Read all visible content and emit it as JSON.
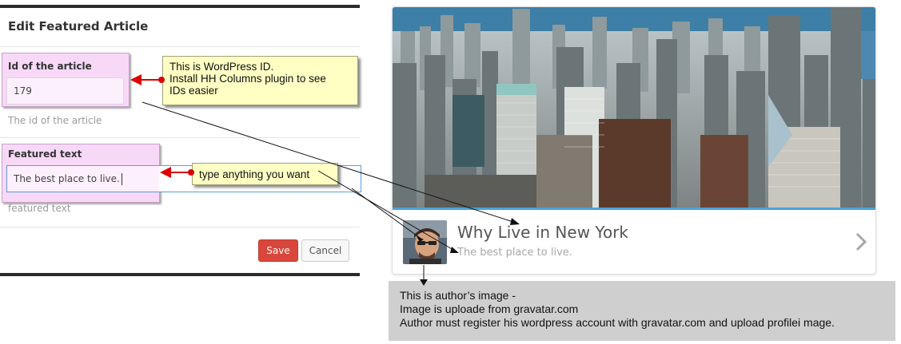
{
  "editor": {
    "title": "Edit Featured Article",
    "fields": [
      {
        "label": "Id of the article",
        "value": "179",
        "help": "The id of the article"
      },
      {
        "label": "Featured text",
        "value": "The best place to live.",
        "help": "featured text"
      }
    ],
    "save_label": "Save",
    "cancel_label": "Cancel"
  },
  "callouts": {
    "id_note": [
      "This is WordPress ID.",
      "Install HH Columns plugin to see",
      "IDs easier"
    ],
    "text_note": "type anything you want"
  },
  "preview": {
    "title": "Why Live in New York",
    "subtitle": "The best place to live.",
    "image": "city-skyline-photo",
    "avatar": "author-avatar-photo",
    "chevron_icon": "chevron-right-icon",
    "accent_color": "#4aa3d8"
  },
  "author_note": [
    "This is author’s image -",
    "Image is uploade from gravatar.com",
    "Author must register his wordpress account with gravatar.com and upload profilei mage."
  ],
  "colors": {
    "save_button": "#d9463b",
    "highlight": "#f7d8f7",
    "callout_bg": "#ffffc4",
    "arrow_red": "#dd0000",
    "note_bg": "#cfcfcf"
  }
}
